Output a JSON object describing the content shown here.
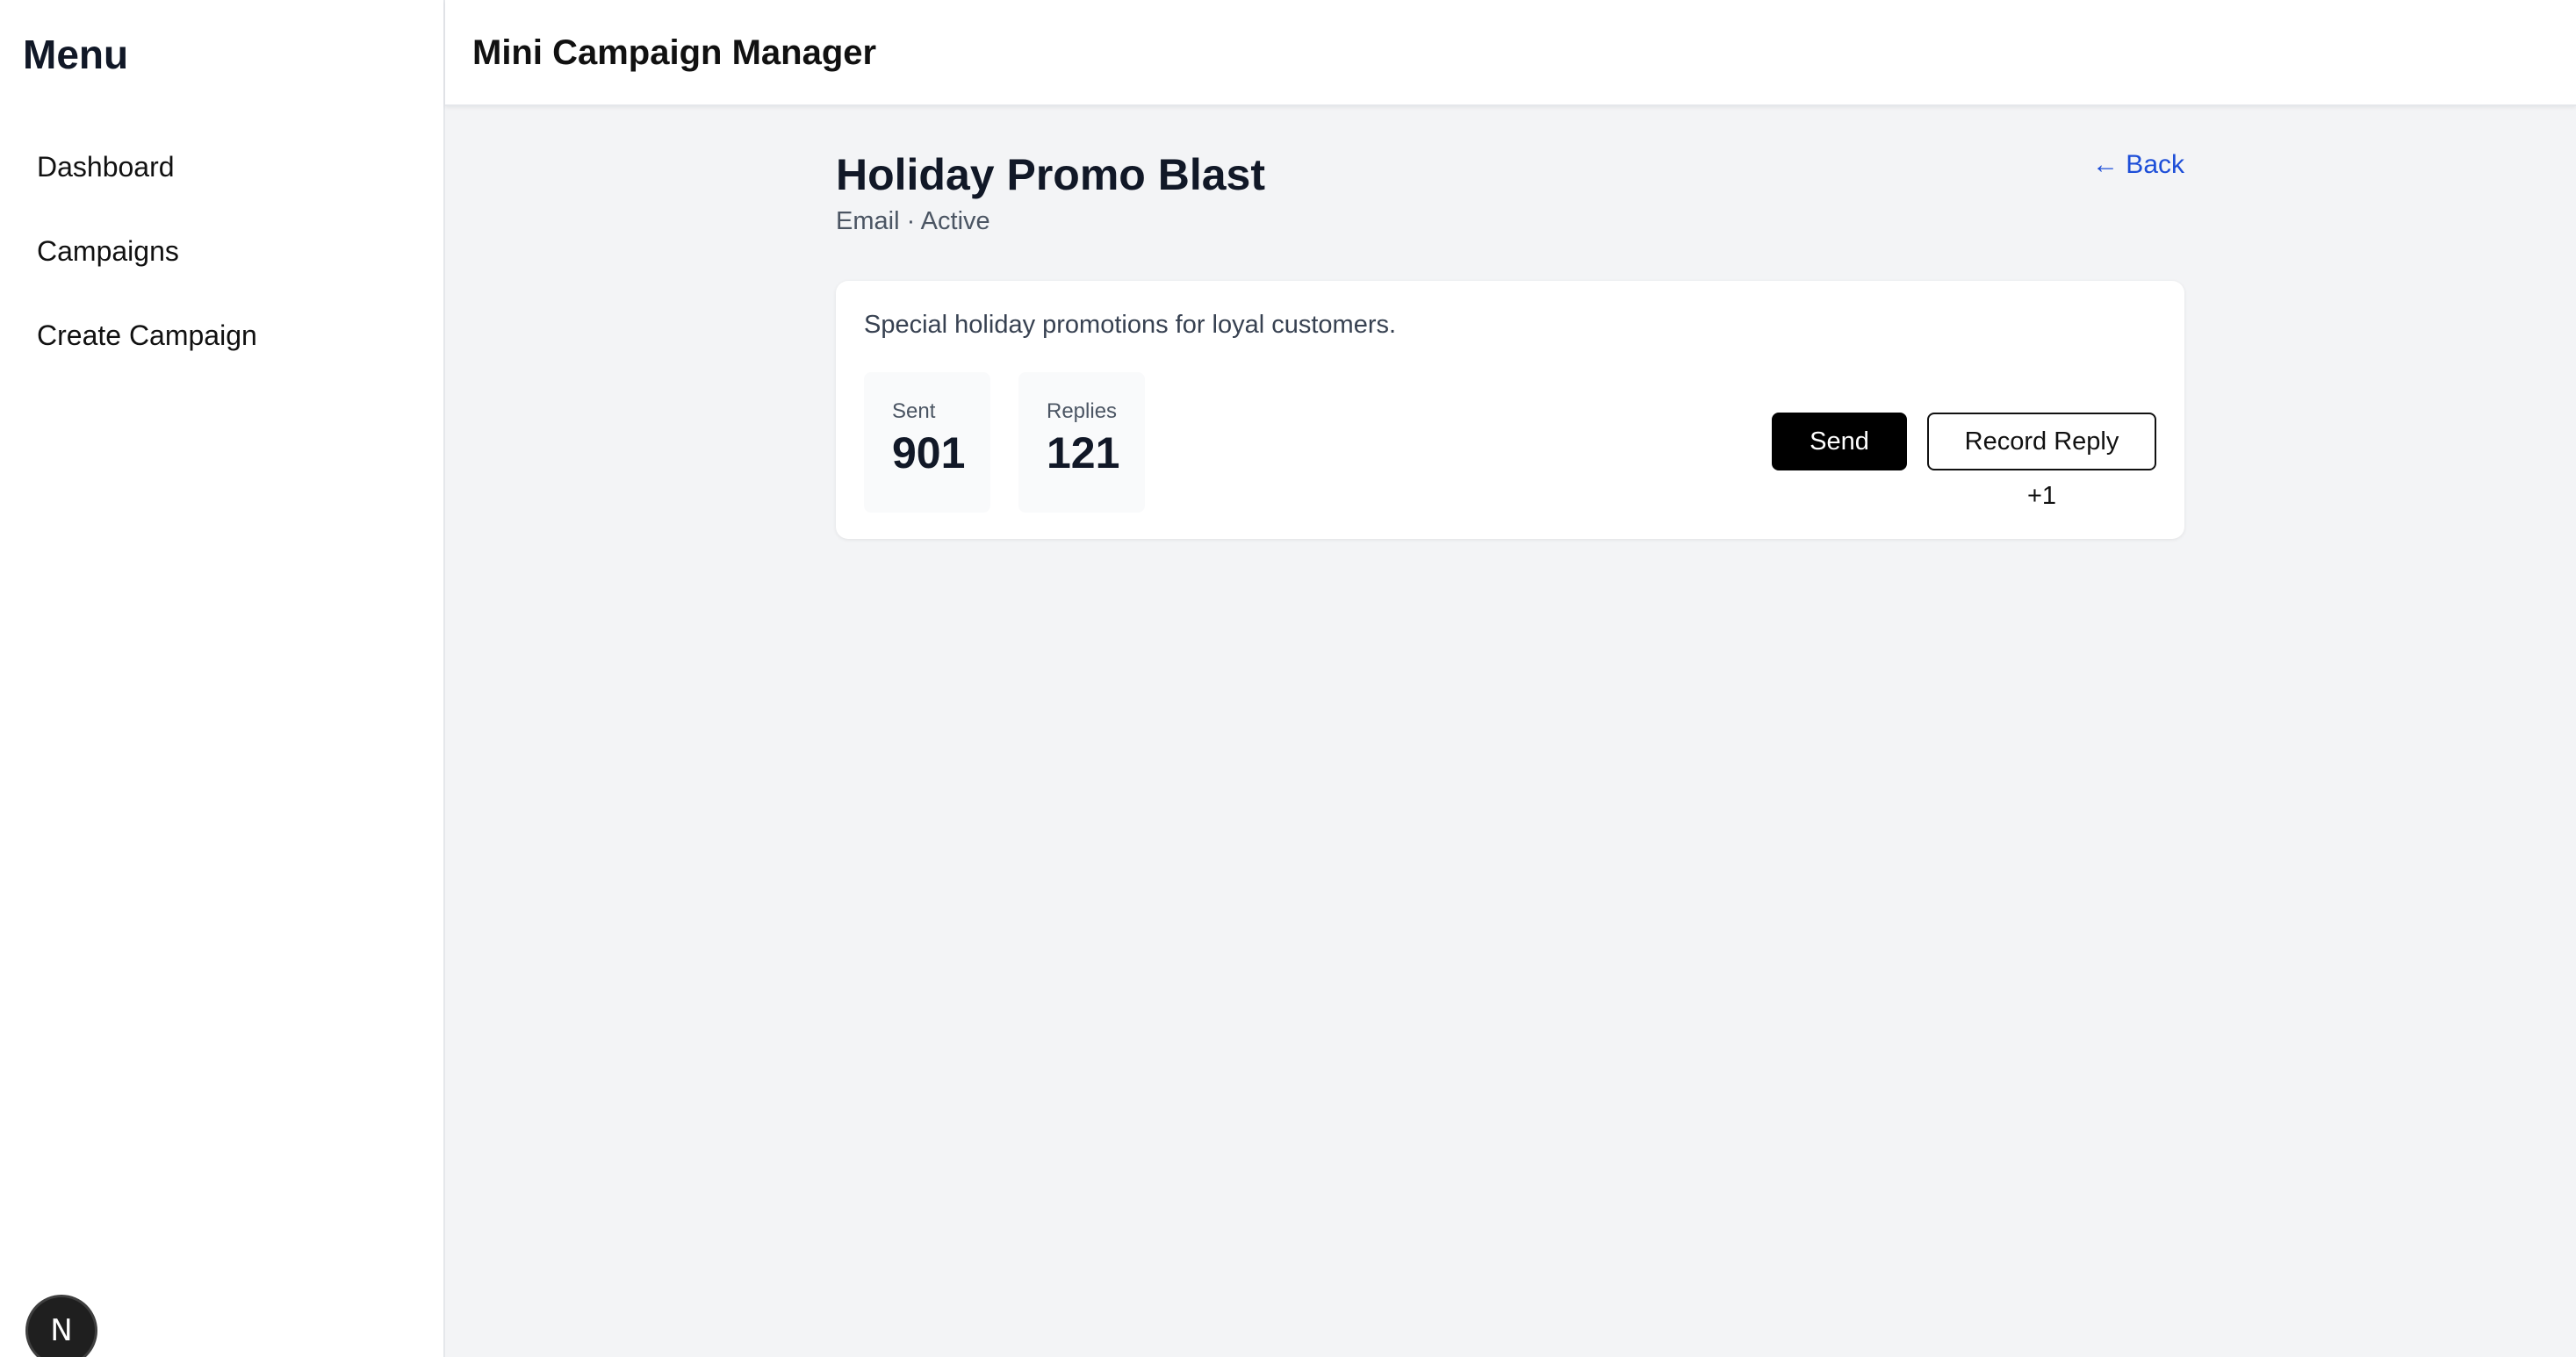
{
  "sidebar": {
    "title": "Menu",
    "items": [
      {
        "label": "Dashboard"
      },
      {
        "label": "Campaigns"
      },
      {
        "label": "Create Campaign"
      }
    ],
    "badge": "N"
  },
  "header": {
    "title": "Mini Campaign Manager"
  },
  "campaign": {
    "title": "Holiday Promo Blast",
    "meta": "Email · Active",
    "back_label": "← Back",
    "description": "Special holiday promotions for loyal customers.",
    "stats": {
      "sent_label": "Sent",
      "sent_value": "901",
      "replies_label": "Replies",
      "replies_value": "121"
    },
    "actions": {
      "send_label": "Send +1",
      "reply_label": "Record Reply +1"
    }
  },
  "colors": {
    "background": "#f3f4f6",
    "link": "#1d4ed8",
    "primary_button": "#000000"
  }
}
